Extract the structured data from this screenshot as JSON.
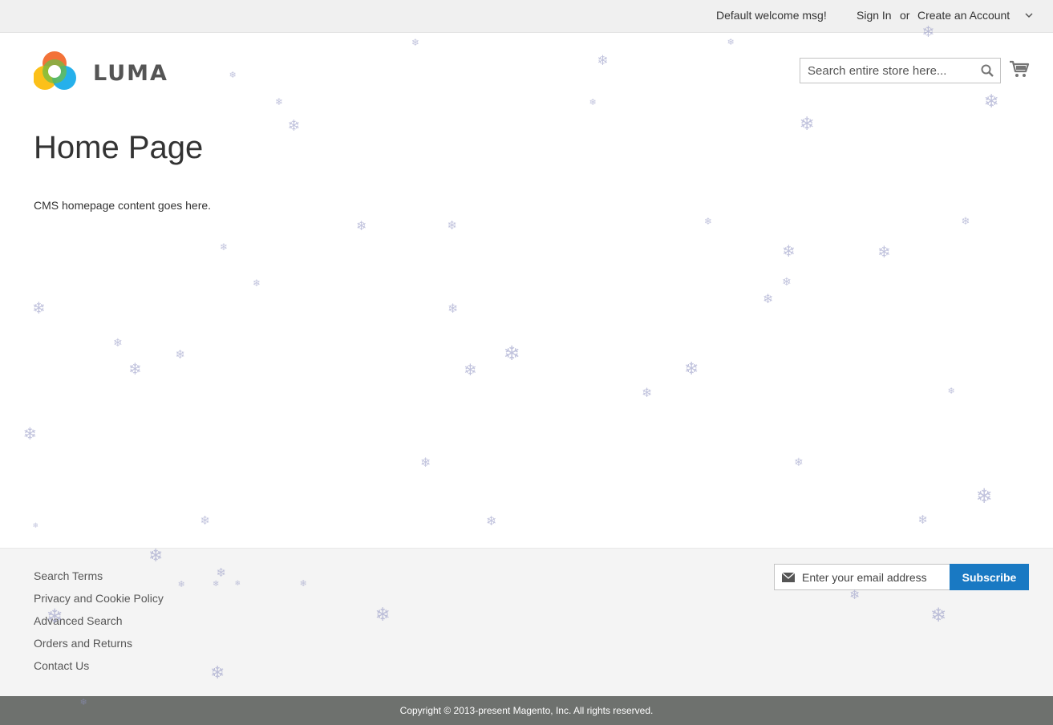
{
  "header": {
    "welcome": "Default welcome msg!",
    "sign_in": "Sign In",
    "or": "or",
    "create_account": "Create an Account",
    "logo_text": "LUMA"
  },
  "search": {
    "placeholder": "Search entire store here...",
    "icon": "search-icon"
  },
  "cart": {
    "icon": "cart-icon"
  },
  "main": {
    "title": "Home Page",
    "content": "CMS homepage content goes here."
  },
  "footer": {
    "links": [
      "Search Terms",
      "Privacy and Cookie Policy",
      "Advanced Search",
      "Orders and Returns",
      "Contact Us"
    ],
    "newsletter": {
      "placeholder": "Enter your email address",
      "button": "Subscribe",
      "icon": "envelope-icon"
    },
    "copyright": "Copyright © 2013-present Magento, Inc. All rights reserved."
  },
  "colors": {
    "accent": "#1979c3",
    "topbar": "#f0f0f0",
    "footer": "#f4f4f4",
    "copyright_bar": "#6e716e",
    "snowflake": "#8f93c2"
  }
}
